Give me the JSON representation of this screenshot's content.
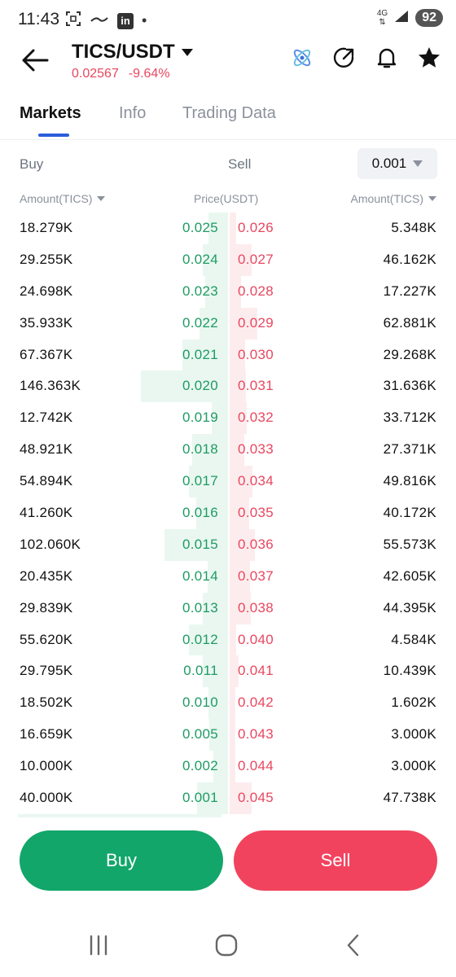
{
  "status_bar": {
    "time": "11:43",
    "network_top": "4G",
    "network_bottom": "⇅",
    "battery": "92",
    "dot": "•",
    "linkedin": "in"
  },
  "header": {
    "pair": "TICS/USDT",
    "price": "0.02567",
    "change": "-9.64%",
    "icons": [
      "back-arrow-icon",
      "atom-icon",
      "share-icon",
      "bell-icon",
      "star-icon"
    ]
  },
  "tabs": [
    {
      "label": "Markets",
      "active": true
    },
    {
      "label": "Info",
      "active": false
    },
    {
      "label": "Trading Data",
      "active": false
    }
  ],
  "order_book": {
    "buy_label": "Buy",
    "sell_label": "Sell",
    "precision": "0.001",
    "headers": {
      "bid_amount": "Amount(TICS)",
      "price": "Price(USDT)",
      "ask_amount": "Amount(TICS)"
    },
    "rows": [
      {
        "bid_amount": "18.279K",
        "bid_price": "0.025",
        "ask_price": "0.026",
        "ask_amount": "5.348K"
      },
      {
        "bid_amount": "29.255K",
        "bid_price": "0.024",
        "ask_price": "0.027",
        "ask_amount": "46.162K"
      },
      {
        "bid_amount": "24.698K",
        "bid_price": "0.023",
        "ask_price": "0.028",
        "ask_amount": "17.227K"
      },
      {
        "bid_amount": "35.933K",
        "bid_price": "0.022",
        "ask_price": "0.029",
        "ask_amount": "62.881K"
      },
      {
        "bid_amount": "67.367K",
        "bid_price": "0.021",
        "ask_price": "0.030",
        "ask_amount": "29.268K"
      },
      {
        "bid_amount": "146.363K",
        "bid_price": "0.020",
        "ask_price": "0.031",
        "ask_amount": "31.636K"
      },
      {
        "bid_amount": "12.742K",
        "bid_price": "0.019",
        "ask_price": "0.032",
        "ask_amount": "33.712K"
      },
      {
        "bid_amount": "48.921K",
        "bid_price": "0.018",
        "ask_price": "0.033",
        "ask_amount": "27.371K"
      },
      {
        "bid_amount": "54.894K",
        "bid_price": "0.017",
        "ask_price": "0.034",
        "ask_amount": "49.816K"
      },
      {
        "bid_amount": "41.260K",
        "bid_price": "0.016",
        "ask_price": "0.035",
        "ask_amount": "40.172K"
      },
      {
        "bid_amount": "102.060K",
        "bid_price": "0.015",
        "ask_price": "0.036",
        "ask_amount": "55.573K"
      },
      {
        "bid_amount": "20.435K",
        "bid_price": "0.014",
        "ask_price": "0.037",
        "ask_amount": "42.605K"
      },
      {
        "bid_amount": "29.839K",
        "bid_price": "0.013",
        "ask_price": "0.038",
        "ask_amount": "44.395K"
      },
      {
        "bid_amount": "55.620K",
        "bid_price": "0.012",
        "ask_price": "0.040",
        "ask_amount": "4.584K"
      },
      {
        "bid_amount": "29.795K",
        "bid_price": "0.011",
        "ask_price": "0.041",
        "ask_amount": "10.439K"
      },
      {
        "bid_amount": "18.502K",
        "bid_price": "0.010",
        "ask_price": "0.042",
        "ask_amount": "1.602K"
      },
      {
        "bid_amount": "16.659K",
        "bid_price": "0.005",
        "ask_price": "0.043",
        "ask_amount": "3.000K"
      },
      {
        "bid_amount": "10.000K",
        "bid_price": "0.002",
        "ask_price": "0.044",
        "ask_amount": "3.000K"
      },
      {
        "bid_amount": "40.000K",
        "bid_price": "0.001",
        "ask_price": "0.045",
        "ask_amount": "47.738K"
      }
    ]
  },
  "actions": {
    "buy_label": "Buy",
    "sell_label": "Sell"
  },
  "nav_bar": {
    "icons": [
      "recent-apps-icon",
      "home-icon",
      "back-icon"
    ]
  },
  "colors": {
    "bid": "#1e9b63",
    "ask": "#e8475f",
    "buy_button": "#12a66a",
    "sell_button": "#f2435e",
    "accent": "#2a5ddb"
  }
}
